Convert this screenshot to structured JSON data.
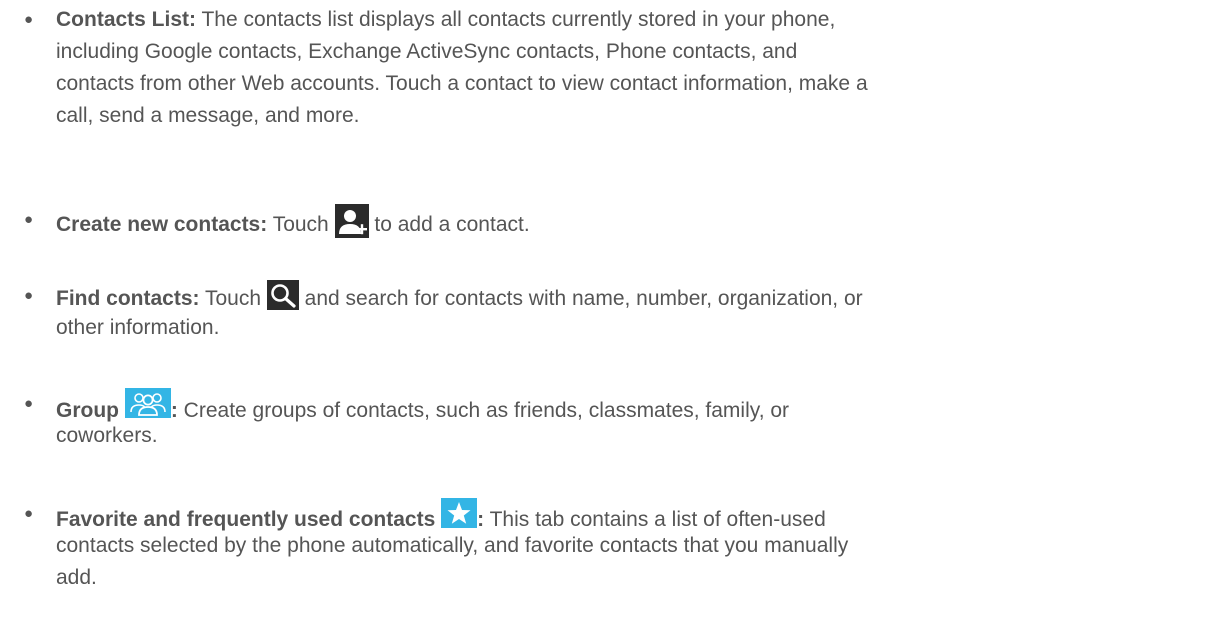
{
  "bullets": [
    {
      "term": "Contacts List:",
      "lines": [
        " The contacts list displays all contacts currently stored in your phone,",
        "including Google contacts, Exchange ActiveSync contacts, Phone contacts, and",
        "contacts from other Web accounts. Touch a contact to view contact information, make a",
        "call, send a message, and more."
      ]
    },
    {
      "term": "Create new contacts:",
      "before_icon": " Touch ",
      "icon": "add-contact-icon",
      "after_icon": " to add a contact."
    },
    {
      "term": "Find contacts:",
      "before_icon": " Touch ",
      "icon": "search-icon",
      "after_icon": " and search for contacts with name, number, organization, or",
      "line2": "other information."
    },
    {
      "term": "Group",
      "icon": "group-tab-icon",
      "colon": ":",
      "after_icon": " Create groups of contacts, such as friends, classmates, family, or",
      "line2": "coworkers."
    },
    {
      "term": "Favorite and frequently used contacts",
      "icon": "favorites-star-icon",
      "colon": ":",
      "after_icon": " This tab contains a list of often-used",
      "line2": "contacts selected by the phone automatically, and favorite contacts that you manually",
      "line3": "add."
    }
  ],
  "colors": {
    "text": "#555555",
    "icon_dark": "#2b2b2b",
    "icon_blue": "#33b5e5"
  }
}
